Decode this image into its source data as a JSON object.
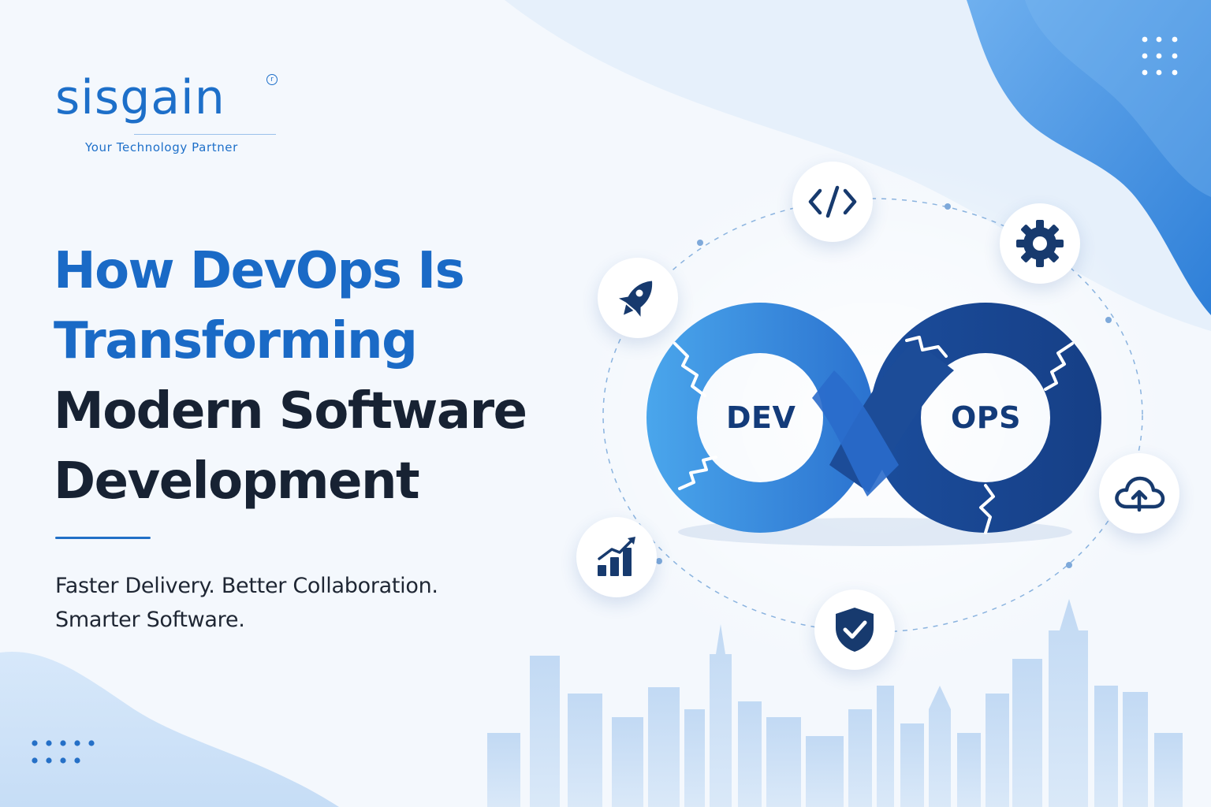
{
  "brand": {
    "name": "sisgain",
    "registered_mark": "r",
    "tagline": "Your Technology Partner"
  },
  "headline": {
    "line1": "How DevOps Is",
    "line2": "Transforming",
    "line3": "Modern Software",
    "line4": "Development"
  },
  "subheadline": {
    "line1": "Faster Delivery. Better Collaboration.",
    "line2": "Smarter Software."
  },
  "infinity_loop": {
    "left_label": "DEV",
    "right_label": "OPS"
  },
  "icons": [
    "code-icon",
    "gear-icon",
    "rocket-icon",
    "cloud-upload-icon",
    "bar-chart-icon",
    "shield-check-icon"
  ],
  "colors": {
    "primary_blue": "#1a6ac6",
    "dark_navy": "#172233",
    "loop_light": "#4aa6ec",
    "loop_dark": "#163f86"
  }
}
